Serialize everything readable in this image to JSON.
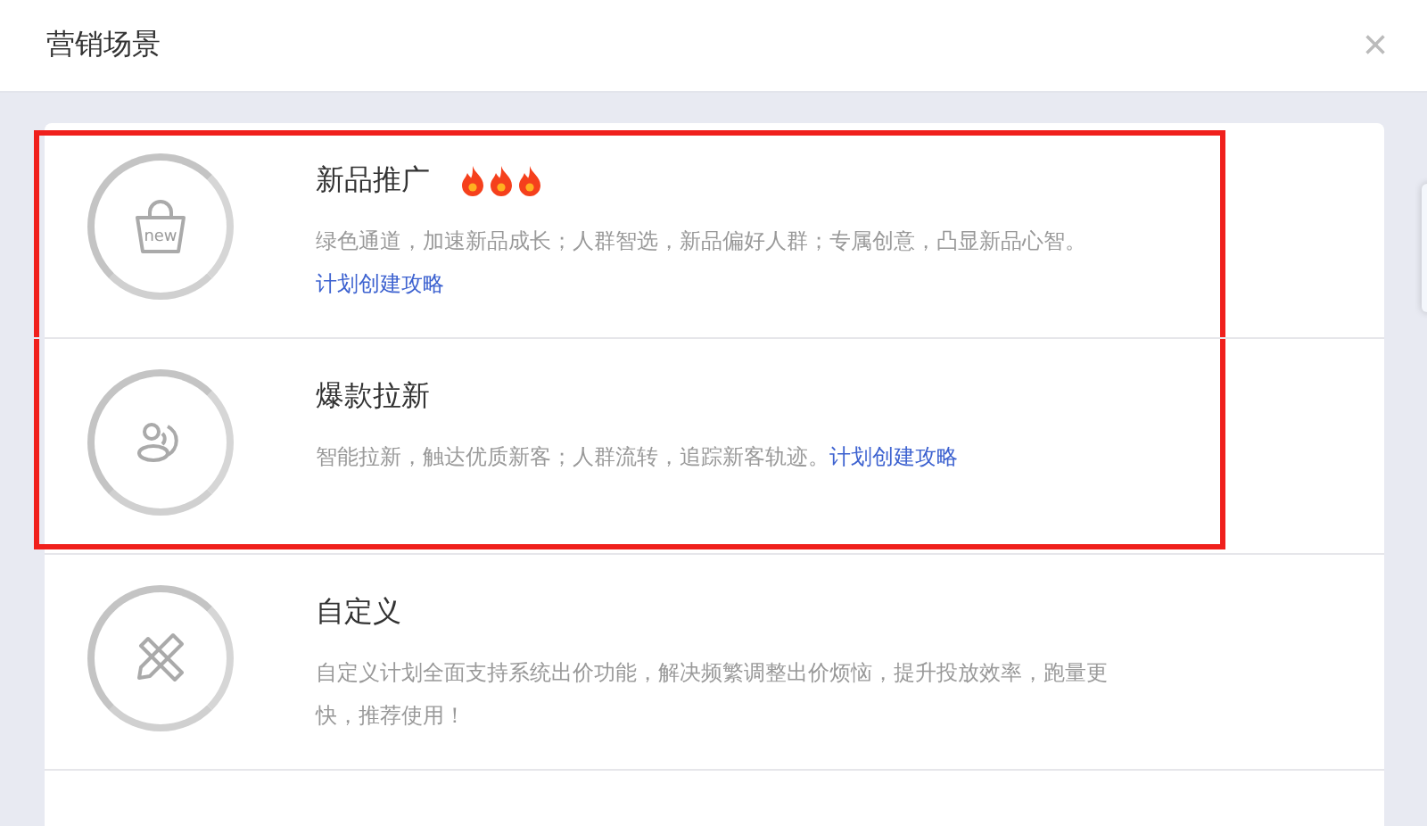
{
  "dialog": {
    "title": "营销场景",
    "close_symbol": "×"
  },
  "scenes": [
    {
      "kind": "new-product",
      "icon_text": "new",
      "title": "新品推广",
      "stars": 3,
      "description": "绿色通道，加速新品成长；人群智选，新品偏好人群；专属创意，凸显新品心智。",
      "link": "计划创建攻略",
      "highlighted": true
    },
    {
      "kind": "audience",
      "title": "爆款拉新",
      "description": "智能拉新，触达优质新客；人群流转，追踪新客轨迹。",
      "link": "计划创建攻略",
      "highlighted": true
    },
    {
      "kind": "custom",
      "title": "自定义",
      "description": "自定义计划全面支持系统出价功能，解决频繁调整出价烦恼，提升投放效率，跑量更快，推荐使用！",
      "highlighted": false
    }
  ]
}
